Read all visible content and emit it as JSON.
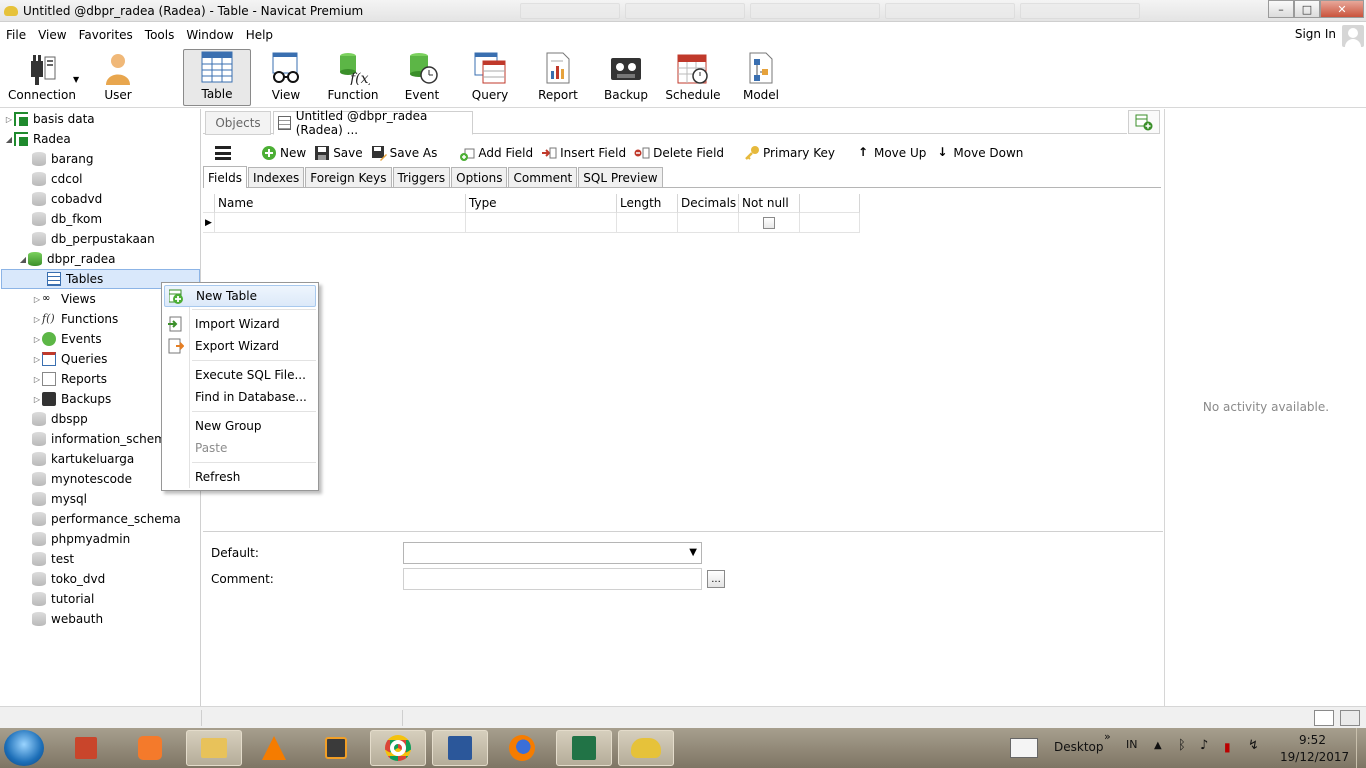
{
  "window": {
    "title": "Untitled @dbpr_radea (Radea) - Table - Navicat Premium",
    "controls": [
      "minimize",
      "maximize",
      "close"
    ]
  },
  "menu": {
    "items": [
      "File",
      "View",
      "Favorites",
      "Tools",
      "Window",
      "Help"
    ],
    "sign_in": "Sign In"
  },
  "toolbar": {
    "buttons": [
      {
        "label": "Connection",
        "icon": "plug-icon"
      },
      {
        "label": "User",
        "icon": "user-icon"
      },
      {
        "label": "Table",
        "icon": "table-icon",
        "active": true
      },
      {
        "label": "View",
        "icon": "glasses-icon"
      },
      {
        "label": "Function",
        "icon": "function-icon"
      },
      {
        "label": "Event",
        "icon": "event-clock-icon"
      },
      {
        "label": "Query",
        "icon": "query-icon"
      },
      {
        "label": "Report",
        "icon": "report-icon"
      },
      {
        "label": "Backup",
        "icon": "backup-icon"
      },
      {
        "label": "Schedule",
        "icon": "calendar-icon"
      },
      {
        "label": "Model",
        "icon": "model-icon"
      }
    ]
  },
  "tree": {
    "connections": [
      {
        "label": "basis data",
        "expanded": false
      },
      {
        "label": "Radea",
        "expanded": true
      }
    ],
    "databases": [
      "barang",
      "cdcol",
      "cobadvd",
      "db_fkom",
      "db_perpustakaan"
    ],
    "open_db": "dbpr_radea",
    "open_db_children": [
      {
        "label": "Tables",
        "icon": "table-icon",
        "selected": true
      },
      {
        "label": "Views",
        "icon": "glasses-icon"
      },
      {
        "label": "Functions",
        "icon": "function-icon"
      },
      {
        "label": "Events",
        "icon": "event-clock-icon"
      },
      {
        "label": "Queries",
        "icon": "query-icon"
      },
      {
        "label": "Reports",
        "icon": "report-icon"
      },
      {
        "label": "Backups",
        "icon": "backup-icon"
      }
    ],
    "databases_after": [
      "dbspp",
      "information_schema",
      "kartukeluarga",
      "mynotescode",
      "mysql",
      "performance_schema",
      "phpmyadmin",
      "test",
      "toko_dvd",
      "tutorial",
      "webauth"
    ]
  },
  "object_tabs": {
    "objects": "Objects",
    "current": "Untitled @dbpr_radea (Radea) ..."
  },
  "design_toolbar": {
    "buttons": [
      "New",
      "Save",
      "Save As",
      "Add Field",
      "Insert Field",
      "Delete Field",
      "Primary Key",
      "Move Up",
      "Move Down"
    ]
  },
  "sub_tabs": {
    "items": [
      "Fields",
      "Indexes",
      "Foreign Keys",
      "Triggers",
      "Options",
      "Comment",
      "SQL Preview"
    ],
    "active": "Fields"
  },
  "grid": {
    "columns": [
      "Name",
      "Type",
      "Length",
      "Decimals",
      "Not null",
      ""
    ],
    "rows": [
      {
        "name": "",
        "type": "",
        "length": "",
        "decimals": "",
        "not_null": false
      }
    ]
  },
  "properties": {
    "default_label": "Default:",
    "default_value": "",
    "comment_label": "Comment:",
    "comment_value": "",
    "ellipsis": "..."
  },
  "right_panel": {
    "message": "No activity available."
  },
  "context_menu": {
    "items": [
      {
        "label": "New Table",
        "icon": "new-table-icon",
        "hover": true
      },
      {
        "label": "Import Wizard",
        "icon": "import-icon"
      },
      {
        "label": "Export Wizard",
        "icon": "export-icon"
      },
      {
        "label": "Execute SQL File..."
      },
      {
        "label": "Find in Database..."
      },
      {
        "label": "New Group"
      },
      {
        "label": "Paste",
        "disabled": true
      },
      {
        "label": "Refresh"
      }
    ]
  },
  "taskbar": {
    "apps": [
      "powerpoint-icon",
      "xampp-icon",
      "file-explorer-icon",
      "vlc-icon",
      "sublime-icon",
      "chrome-icon",
      "word-icon",
      "firefox-icon",
      "excel-icon",
      "navicat-icon"
    ],
    "desktop_label": "Desktop",
    "chevron": "»",
    "language": "IN",
    "time": "9:52",
    "date": "19/12/2017"
  },
  "colors": {
    "accent_green": "#3b8f2a",
    "selection": "#d9e8fb",
    "taskbar": "#8f8776"
  }
}
